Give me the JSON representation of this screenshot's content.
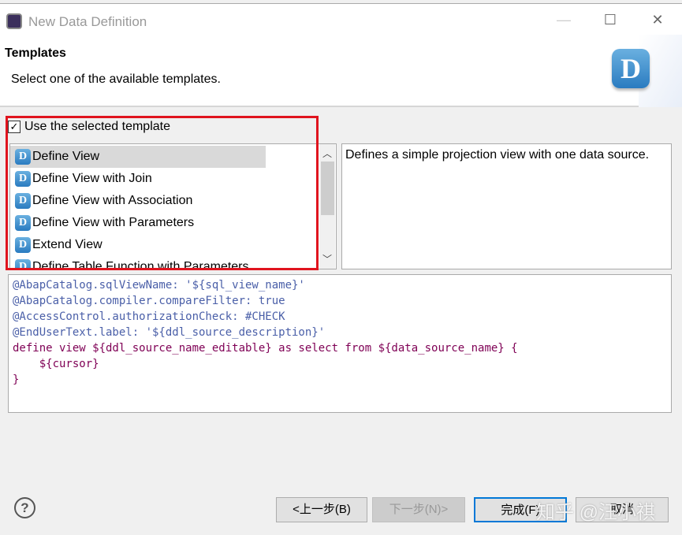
{
  "window": {
    "title": "New Data Definition",
    "minimize": "—",
    "maximize": "☐",
    "close": "✕"
  },
  "header": {
    "title": "Templates",
    "subtitle": "Select one of the available templates.",
    "logo": "D"
  },
  "use_template": {
    "label": "Use the selected template",
    "checked": true
  },
  "templates": {
    "items": [
      {
        "label": "Define View",
        "selected": true
      },
      {
        "label": "Define View with Join"
      },
      {
        "label": "Define View with Association"
      },
      {
        "label": "Define View with Parameters"
      },
      {
        "label": "Extend View"
      },
      {
        "label": "Define Table Function with Parameters"
      }
    ]
  },
  "description": "Defines a simple projection view with one data source.",
  "code": {
    "lines": [
      "@AbapCatalog.sqlViewName: '${sql_view_name}'",
      "@AbapCatalog.compiler.compareFilter: true",
      "@AccessControl.authorizationCheck: #CHECK",
      "@EndUserText.label: '${ddl_source_description}'",
      "define view ${ddl_source_name_editable} as select from ${data_source_name} {",
      "    ${cursor}",
      "}"
    ]
  },
  "buttons": {
    "help": "?",
    "back": "<上一步(B)",
    "next": "下一步(N)>",
    "finish": "完成(F)",
    "cancel": "取消"
  },
  "watermark": "知乎 @汪小祺",
  "colors": {
    "highlight": "#e0141e",
    "annotation": "#4a5fa8",
    "keyword": "#7f0055",
    "default_button": "#0078d7"
  }
}
